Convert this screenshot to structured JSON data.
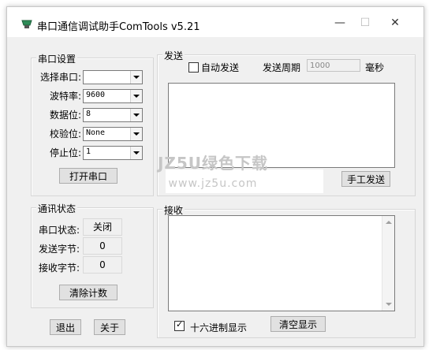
{
  "window": {
    "title": "串口通信调试助手ComTools v5.21",
    "controls": {
      "minimize": "—",
      "maximize": "☐",
      "close": "✕"
    }
  },
  "serial_settings": {
    "group_label": "串口设置",
    "port_label": "选择串口:",
    "port_value": "",
    "baud_label": "波特率:",
    "baud_value": "9600",
    "databits_label": "数据位:",
    "databits_value": "8",
    "parity_label": "校验位:",
    "parity_value": "None",
    "stopbits_label": "停止位:",
    "stopbits_value": "1",
    "open_button": "打开串口"
  },
  "status": {
    "group_label": "通讯状态",
    "port_state_label": "串口状态:",
    "port_state_value": "关闭",
    "sent_label": "发送字节:",
    "sent_value": "0",
    "received_label": "接收字节:",
    "received_value": "0",
    "clear_button": "清除计数"
  },
  "footer": {
    "exit_button": "退出",
    "about_button": "关于"
  },
  "send": {
    "group_label": "发送",
    "auto_send_label": "自动发送",
    "auto_send_checked": false,
    "period_label": "发送周期",
    "period_value": "1000",
    "period_unit": "毫秒",
    "manual_send_button": "手工发送"
  },
  "receive": {
    "group_label": "接收",
    "hex_display_label": "十六进制显示",
    "hex_display_checked": true,
    "clear_display_button": "清空显示"
  },
  "watermark": {
    "line1": "JZ5U绿色下载",
    "line2": "www.jz5u.com"
  }
}
